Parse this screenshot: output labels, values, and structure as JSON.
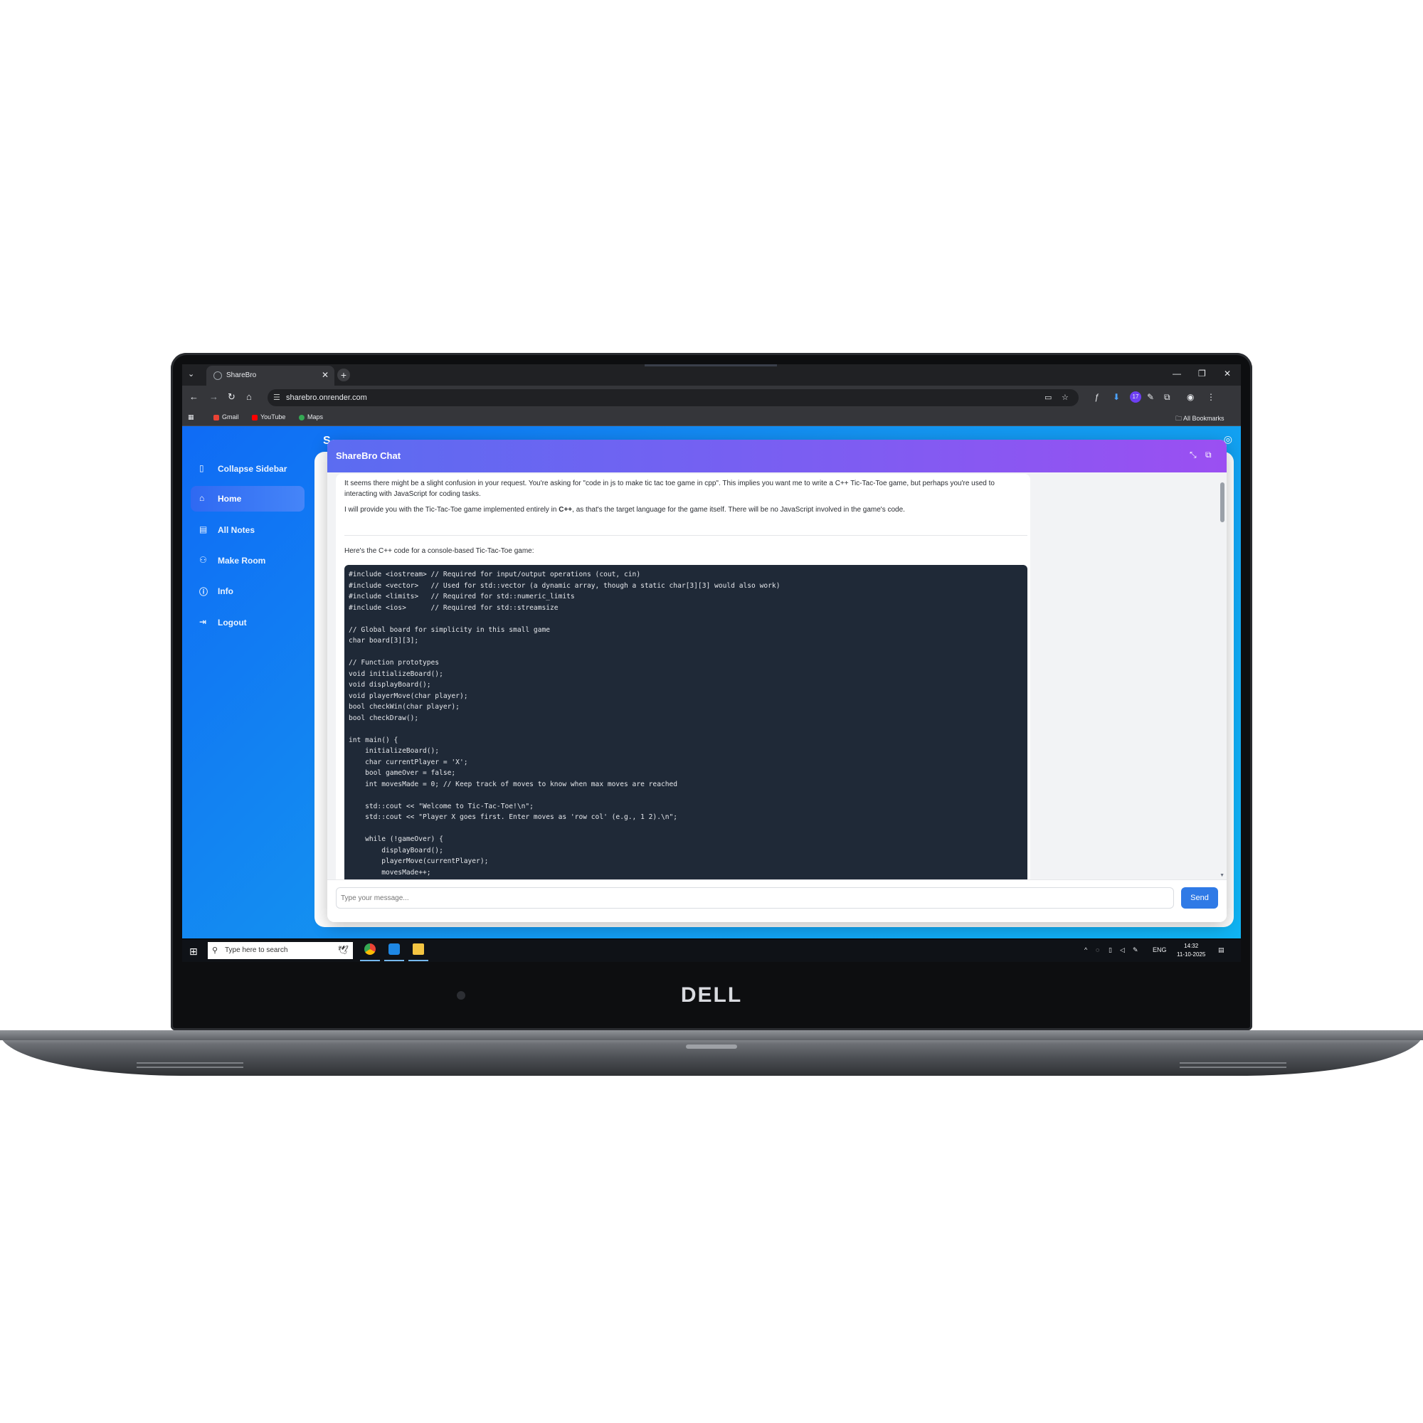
{
  "device": {
    "brand": "DELL"
  },
  "browser": {
    "tab_title": "ShareBro",
    "tab_close": "✕",
    "new_tab": "+",
    "url": "sharebro.onrender.com",
    "bookmarks": [
      {
        "label": "Gmail",
        "color": "#ea4335"
      },
      {
        "label": "YouTube",
        "color": "#ff0000"
      },
      {
        "label": "Maps",
        "color": "#34a853"
      }
    ],
    "all_bookmarks": "All Bookmarks",
    "ext_badge": "17"
  },
  "app": {
    "header_partial": "S",
    "sidebar": [
      {
        "label": "Collapse Sidebar",
        "icon": "sidebar-icon",
        "active": false
      },
      {
        "label": "Home",
        "icon": "home-icon",
        "active": true
      },
      {
        "label": "All Notes",
        "icon": "notes-icon",
        "active": false
      },
      {
        "label": "Make Room",
        "icon": "add-user-icon",
        "active": false
      },
      {
        "label": "Info",
        "icon": "info-icon",
        "active": false
      },
      {
        "label": "Logout",
        "icon": "logout-icon",
        "active": false
      }
    ]
  },
  "chat": {
    "title": "ShareBro Chat",
    "message": {
      "para1": "It seems there might be a slight confusion in your request. You're asking for \"code in js to make tic tac toe game in cpp\". This implies you want me to write a C++ Tic-Tac-Toe game, but perhaps you're used to interacting with JavaScript for coding tasks.",
      "para2_before": "I will provide you with the Tic-Tac-Toe game implemented entirely in ",
      "para2_bold": "C++",
      "para2_after": ", as that's the target language for the game itself. There will be no JavaScript involved in the game's code.",
      "para3": "Here's the C++ code for a console-based Tic-Tac-Toe game:",
      "code": "#include <iostream> // Required for input/output operations (cout, cin)\n#include <vector>   // Used for std::vector (a dynamic array, though a static char[3][3] would also work)\n#include <limits>   // Required for std::numeric_limits\n#include <ios>      // Required for std::streamsize\n\n// Global board for simplicity in this small game\nchar board[3][3];\n\n// Function prototypes\nvoid initializeBoard();\nvoid displayBoard();\nvoid playerMove(char player);\nbool checkWin(char player);\nbool checkDraw();\n\nint main() {\n    initializeBoard();\n    char currentPlayer = 'X';\n    bool gameOver = false;\n    int movesMade = 0; // Keep track of moves to know when max moves are reached\n\n    std::cout << \"Welcome to Tic-Tac-Toe!\\n\";\n    std::cout << \"Player X goes first. Enter moves as 'row col' (e.g., 1 2).\\n\";\n\n    while (!gameOver) {\n        displayBoard();\n        playerMove(currentPlayer);\n        movesMade++;"
    },
    "input_placeholder": "Type your message...",
    "send_label": "Send"
  },
  "taskbar": {
    "search_placeholder": "Type here to search",
    "lang": "ENG",
    "time": "14:32",
    "date": "11-10-2025"
  }
}
